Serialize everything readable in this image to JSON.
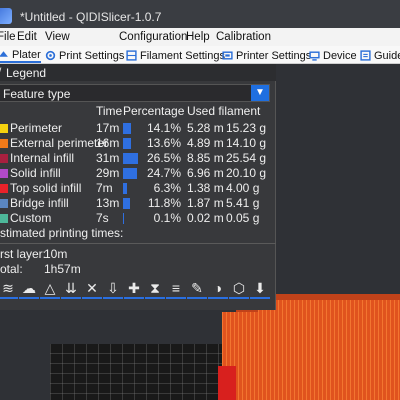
{
  "window": {
    "title": "*Untitled - QIDISlicer-1.0.7"
  },
  "menu": [
    "File",
    "Edit",
    "View",
    "Configuration",
    "Help",
    "Calibration"
  ],
  "tabs": [
    {
      "label": "Plater",
      "icon": "plater-icon",
      "active": true
    },
    {
      "label": "Print Settings",
      "icon": "print-settings-icon"
    },
    {
      "label": "Filament Settings",
      "icon": "filament-settings-icon"
    },
    {
      "label": "Printer Settings",
      "icon": "printer-settings-icon"
    },
    {
      "label": "Device",
      "icon": "device-icon"
    },
    {
      "label": "Guide",
      "icon": "guide-icon"
    }
  ],
  "legend": {
    "title": "Legend",
    "view_type": "Feature type",
    "headers": {
      "time": "Time",
      "percentage": "Percentage",
      "used_filament": "Used filament"
    },
    "rows": [
      {
        "name": "Perimeter",
        "color": "#f5d20f",
        "time": "17m",
        "percent": "14.1%",
        "pct_value": 14.1,
        "length": "5.28 m",
        "weight": "15.23 g"
      },
      {
        "name": "External perimeter",
        "color": "#f07a1a",
        "time": "16m",
        "percent": "13.6%",
        "pct_value": 13.6,
        "length": "4.89 m",
        "weight": "14.10 g"
      },
      {
        "name": "Internal infill",
        "color": "#a8203f",
        "time": "31m",
        "percent": "26.5%",
        "pct_value": 26.5,
        "length": "8.85 m",
        "weight": "25.54 g"
      },
      {
        "name": "Solid infill",
        "color": "#b24ac8",
        "time": "29m",
        "percent": "24.7%",
        "pct_value": 24.7,
        "length": "6.96 m",
        "weight": "20.10 g"
      },
      {
        "name": "Top solid infill",
        "color": "#e8222a",
        "time": "7m",
        "percent": "6.3%",
        "pct_value": 6.3,
        "length": "1.38 m",
        "weight": "4.00 g"
      },
      {
        "name": "Bridge infill",
        "color": "#5a86c0",
        "time": "13m",
        "percent": "11.8%",
        "pct_value": 11.8,
        "length": "1.87 m",
        "weight": "5.41 g"
      },
      {
        "name": "Custom",
        "color": "#4db89a",
        "time": "7s",
        "percent": "0.1%",
        "pct_value": 0.1,
        "length": "0.02 m",
        "weight": "0.05 g"
      }
    ],
    "estimated_label": "stimated printing times:",
    "first_layer_label": "rst layer:",
    "first_layer_value": "10m",
    "total_label": "otal:",
    "total_value": "1h57m"
  },
  "toolbar": [
    {
      "name": "layers-view-icon",
      "glyph": "≋"
    },
    {
      "name": "cloud-icon",
      "glyph": "☁"
    },
    {
      "name": "wedge-icon",
      "glyph": "△"
    },
    {
      "name": "tool-select-icon",
      "glyph": "⇊"
    },
    {
      "name": "wipe-icon",
      "glyph": "✕"
    },
    {
      "name": "seam-icon",
      "glyph": "⇩"
    },
    {
      "name": "color-change-icon",
      "glyph": "✚"
    },
    {
      "name": "pause-icon",
      "glyph": "⧗"
    },
    {
      "name": "custom-gcode-icon",
      "glyph": "≡"
    },
    {
      "name": "pencil-icon",
      "glyph": "✎"
    },
    {
      "name": "shells-icon",
      "glyph": "◑"
    },
    {
      "name": "cube-icon",
      "glyph": "⬡"
    },
    {
      "name": "download-icon",
      "glyph": "⬇"
    }
  ]
}
